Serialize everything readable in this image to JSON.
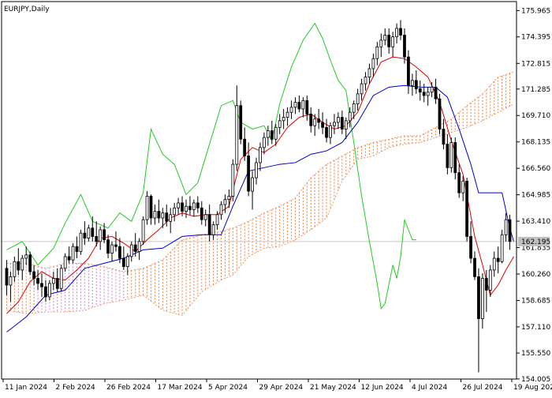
{
  "window": {
    "symbol_label": "EURJPY,Daily"
  },
  "chart_data": {
    "type": "candlestick",
    "title": "EURJPY,Daily",
    "ylim": [
      154.0,
      176.5
    ],
    "y_ticks": [
      "175.965",
      "174.395",
      "172.815",
      "171.285",
      "169.710",
      "168.135",
      "166.560",
      "164.985",
      "163.410",
      "161.835",
      "160.260",
      "158.685",
      "157.110",
      "155.550",
      "154.005"
    ],
    "x_ticks": [
      "11 Jan 2024",
      "2 Feb 2024",
      "26 Feb 2024",
      "17 Mar 2024",
      "5 Apr 2024",
      "29 Apr 2024",
      "21 May 2024",
      "12 Jun 2024",
      "4 Jul 2024",
      "26 Jul 2024",
      "19 Aug 2024"
    ],
    "last_price": "162.195",
    "colors": {
      "candle": "#000000",
      "tenkan": "#dd0000",
      "kijun": "#0000cc",
      "chikou": "#22cc22",
      "cloud": "#f08040",
      "cloud_alt": "#cc88cc",
      "grid": "#c8c8c8",
      "price_tag": "#c0c0c0"
    },
    "candles": [
      [
        160.6,
        161.1,
        159.0,
        159.6
      ],
      [
        159.6,
        160.4,
        158.6,
        160.1
      ],
      [
        160.1,
        161.3,
        159.8,
        161.0
      ],
      [
        161.0,
        161.8,
        160.2,
        160.5
      ],
      [
        160.5,
        161.4,
        159.9,
        161.2
      ],
      [
        161.2,
        161.9,
        160.8,
        161.4
      ],
      [
        161.4,
        161.6,
        160.2,
        160.4
      ],
      [
        160.4,
        160.8,
        159.6,
        160.0
      ],
      [
        160.0,
        160.5,
        159.3,
        159.7
      ],
      [
        159.7,
        160.3,
        158.9,
        159.5
      ],
      [
        159.5,
        159.9,
        158.6,
        158.9
      ],
      [
        158.9,
        159.9,
        158.7,
        159.7
      ],
      [
        159.7,
        160.4,
        159.3,
        160.0
      ],
      [
        160.0,
        160.6,
        159.2,
        159.4
      ],
      [
        159.4,
        160.8,
        159.2,
        160.6
      ],
      [
        160.6,
        161.5,
        160.4,
        161.3
      ],
      [
        161.3,
        161.9,
        160.9,
        161.1
      ],
      [
        161.1,
        162.1,
        160.9,
        161.9
      ],
      [
        161.9,
        162.5,
        161.2,
        161.6
      ],
      [
        161.6,
        162.9,
        161.4,
        162.7
      ],
      [
        162.7,
        163.4,
        162.0,
        162.4
      ],
      [
        162.4,
        163.2,
        162.2,
        163.0
      ],
      [
        163.0,
        163.7,
        162.2,
        162.5
      ],
      [
        162.5,
        163.4,
        161.9,
        162.2
      ],
      [
        162.2,
        163.1,
        161.7,
        162.9
      ],
      [
        162.9,
        163.3,
        162.1,
        162.3
      ],
      [
        162.3,
        162.6,
        161.2,
        161.5
      ],
      [
        161.5,
        162.2,
        161.0,
        162.0
      ],
      [
        162.0,
        162.8,
        161.6,
        161.9
      ],
      [
        161.9,
        162.4,
        160.9,
        161.2
      ],
      [
        161.2,
        161.9,
        160.5,
        160.7
      ],
      [
        160.7,
        161.5,
        160.2,
        161.3
      ],
      [
        161.3,
        162.2,
        161.0,
        162.0
      ],
      [
        162.0,
        162.7,
        161.3,
        161.6
      ],
      [
        161.6,
        162.4,
        161.1,
        162.2
      ],
      [
        162.2,
        163.7,
        162.0,
        163.5
      ],
      [
        163.5,
        165.2,
        163.2,
        164.9
      ],
      [
        164.9,
        165.0,
        163.2,
        163.6
      ],
      [
        163.6,
        164.4,
        163.2,
        164.0
      ],
      [
        164.0,
        164.7,
        163.3,
        163.6
      ],
      [
        163.6,
        164.2,
        163.0,
        163.9
      ],
      [
        163.9,
        164.4,
        163.1,
        163.4
      ],
      [
        163.4,
        164.2,
        162.7,
        163.8
      ],
      [
        163.8,
        164.5,
        163.4,
        164.2
      ],
      [
        164.2,
        164.8,
        163.8,
        164.5
      ],
      [
        164.5,
        164.9,
        163.7,
        164.0
      ],
      [
        164.0,
        164.7,
        163.6,
        164.3
      ],
      [
        164.3,
        164.9,
        163.8,
        164.1
      ],
      [
        164.1,
        164.7,
        163.7,
        164.5
      ],
      [
        164.5,
        164.9,
        163.9,
        164.2
      ],
      [
        164.2,
        164.6,
        163.2,
        163.5
      ],
      [
        163.5,
        164.1,
        163.1,
        163.8
      ],
      [
        163.8,
        164.4,
        162.2,
        162.6
      ],
      [
        162.6,
        163.4,
        162.3,
        163.2
      ],
      [
        163.2,
        164.0,
        162.9,
        163.8
      ],
      [
        163.8,
        164.6,
        163.5,
        164.4
      ],
      [
        164.4,
        165.0,
        163.9,
        164.7
      ],
      [
        164.7,
        165.3,
        164.2,
        164.9
      ],
      [
        164.9,
        167.1,
        164.6,
        166.8
      ],
      [
        166.8,
        171.5,
        166.4,
        170.3
      ],
      [
        170.3,
        170.6,
        168.0,
        168.3
      ],
      [
        168.3,
        169.0,
        167.0,
        167.3
      ],
      [
        167.3,
        168.1,
        164.9,
        165.2
      ],
      [
        165.2,
        166.4,
        164.1,
        166.0
      ],
      [
        166.0,
        167.2,
        165.6,
        166.9
      ],
      [
        166.9,
        168.1,
        166.4,
        167.8
      ],
      [
        167.8,
        168.7,
        167.4,
        168.4
      ],
      [
        168.4,
        169.1,
        167.9,
        168.8
      ],
      [
        168.8,
        169.4,
        168.0,
        168.3
      ],
      [
        168.3,
        169.2,
        167.9,
        169.0
      ],
      [
        169.0,
        169.8,
        168.6,
        169.4
      ],
      [
        169.4,
        170.1,
        168.9,
        169.6
      ],
      [
        169.6,
        170.2,
        169.1,
        169.9
      ],
      [
        169.9,
        170.6,
        169.5,
        170.2
      ],
      [
        170.2,
        170.8,
        169.8,
        170.5
      ],
      [
        170.5,
        170.9,
        169.9,
        170.1
      ],
      [
        170.1,
        170.8,
        169.6,
        170.6
      ],
      [
        170.6,
        170.9,
        169.4,
        169.8
      ],
      [
        169.8,
        170.2,
        168.7,
        169.1
      ],
      [
        169.1,
        169.8,
        168.5,
        169.5
      ],
      [
        169.5,
        170.1,
        168.9,
        169.3
      ],
      [
        169.3,
        169.9,
        168.6,
        169.0
      ],
      [
        169.0,
        169.5,
        168.1,
        168.4
      ],
      [
        168.4,
        169.3,
        168.0,
        169.1
      ],
      [
        169.1,
        169.8,
        168.6,
        169.3
      ],
      [
        169.3,
        169.9,
        168.9,
        169.6
      ],
      [
        169.6,
        170.0,
        168.6,
        168.9
      ],
      [
        168.9,
        169.6,
        168.3,
        169.4
      ],
      [
        169.4,
        170.2,
        169.0,
        169.9
      ],
      [
        169.9,
        170.6,
        169.5,
        170.4
      ],
      [
        170.4,
        171.3,
        170.0,
        171.0
      ],
      [
        171.0,
        171.9,
        170.6,
        171.6
      ],
      [
        171.6,
        172.3,
        171.2,
        172.0
      ],
      [
        172.0,
        172.8,
        171.6,
        172.5
      ],
      [
        172.5,
        173.4,
        172.0,
        173.1
      ],
      [
        173.1,
        174.1,
        172.7,
        173.8
      ],
      [
        173.8,
        174.6,
        173.2,
        174.2
      ],
      [
        174.2,
        174.9,
        173.9,
        174.5
      ],
      [
        174.5,
        174.9,
        173.4,
        173.8
      ],
      [
        173.8,
        174.7,
        173.2,
        174.4
      ],
      [
        174.4,
        175.2,
        174.0,
        174.9
      ],
      [
        174.9,
        175.4,
        174.2,
        174.5
      ],
      [
        174.5,
        174.9,
        172.8,
        173.2
      ],
      [
        173.2,
        173.6,
        171.0,
        171.5
      ],
      [
        171.5,
        172.2,
        170.9,
        171.8
      ],
      [
        171.8,
        172.4,
        171.0,
        171.3
      ],
      [
        171.3,
        171.8,
        170.6,
        171.1
      ],
      [
        171.1,
        171.6,
        170.5,
        170.9
      ],
      [
        170.9,
        171.4,
        170.3,
        171.1
      ],
      [
        171.1,
        171.7,
        170.8,
        171.4
      ],
      [
        171.4,
        171.9,
        170.4,
        170.7
      ],
      [
        170.7,
        171.0,
        168.6,
        168.9
      ],
      [
        168.9,
        169.5,
        167.7,
        168.0
      ],
      [
        168.0,
        168.6,
        166.2,
        166.6
      ],
      [
        166.6,
        168.4,
        166.3,
        168.1
      ],
      [
        168.1,
        168.4,
        165.9,
        166.3
      ],
      [
        166.3,
        166.8,
        164.8,
        165.1
      ],
      [
        165.1,
        166.1,
        164.6,
        165.8
      ],
      [
        165.8,
        166.0,
        162.2,
        162.5
      ],
      [
        162.5,
        163.4,
        160.9,
        161.2
      ],
      [
        161.2,
        161.6,
        159.9,
        160.1
      ],
      [
        160.1,
        160.6,
        154.4,
        157.6
      ],
      [
        157.6,
        160.3,
        157.0,
        160.0
      ],
      [
        160.0,
        160.5,
        158.0,
        159.3
      ],
      [
        159.3,
        160.8,
        158.9,
        160.5
      ],
      [
        160.5,
        161.6,
        160.1,
        161.2
      ],
      [
        161.2,
        161.9,
        160.3,
        161.0
      ],
      [
        161.0,
        162.9,
        160.9,
        162.6
      ],
      [
        162.6,
        163.9,
        162.2,
        163.5
      ],
      [
        163.5,
        163.8,
        161.7,
        162.2
      ]
    ],
    "tenkan": [
      [
        0,
        157.9
      ],
      [
        3,
        158.6
      ],
      [
        6,
        159.8
      ],
      [
        9,
        160.4
      ],
      [
        12,
        160.0
      ],
      [
        15,
        159.9
      ],
      [
        18,
        160.5
      ],
      [
        21,
        161.2
      ],
      [
        24,
        162.4
      ],
      [
        27,
        162.5
      ],
      [
        30,
        162.1
      ],
      [
        33,
        161.6
      ],
      [
        36,
        162.3
      ],
      [
        39,
        162.9
      ],
      [
        42,
        163.6
      ],
      [
        45,
        163.9
      ],
      [
        48,
        163.7
      ],
      [
        51,
        163.8
      ],
      [
        54,
        163.8
      ],
      [
        57,
        164.3
      ],
      [
        60,
        167.1
      ],
      [
        63,
        167.8
      ],
      [
        66,
        167.5
      ],
      [
        69,
        168.0
      ],
      [
        72,
        169.0
      ],
      [
        75,
        169.6
      ],
      [
        78,
        169.8
      ],
      [
        81,
        169.3
      ],
      [
        84,
        168.9
      ],
      [
        87,
        169.1
      ],
      [
        90,
        169.9
      ],
      [
        93,
        171.6
      ],
      [
        96,
        172.9
      ],
      [
        99,
        173.2
      ],
      [
        102,
        173.1
      ],
      [
        105,
        172.6
      ],
      [
        108,
        172.0
      ],
      [
        111,
        170.5
      ],
      [
        114,
        168.2
      ],
      [
        117,
        166.2
      ],
      [
        120,
        162.5
      ],
      [
        122,
        160.8
      ],
      [
        124,
        159.0
      ],
      [
        126,
        159.6
      ],
      [
        128,
        160.5
      ],
      [
        130,
        161.3
      ]
    ],
    "kijun": [
      [
        0,
        156.8
      ],
      [
        5,
        157.7
      ],
      [
        10,
        159.0
      ],
      [
        15,
        159.3
      ],
      [
        20,
        160.6
      ],
      [
        25,
        160.9
      ],
      [
        30,
        161.2
      ],
      [
        35,
        161.7
      ],
      [
        40,
        161.8
      ],
      [
        45,
        162.5
      ],
      [
        50,
        162.6
      ],
      [
        55,
        162.6
      ],
      [
        58,
        164.3
      ],
      [
        62,
        166.4
      ],
      [
        66,
        166.6
      ],
      [
        70,
        166.8
      ],
      [
        74,
        166.9
      ],
      [
        78,
        167.4
      ],
      [
        82,
        167.6
      ],
      [
        86,
        168.1
      ],
      [
        90,
        169.3
      ],
      [
        94,
        170.9
      ],
      [
        98,
        171.4
      ],
      [
        102,
        171.5
      ],
      [
        106,
        171.4
      ],
      [
        110,
        171.4
      ],
      [
        113,
        170.8
      ],
      [
        116,
        168.9
      ],
      [
        119,
        166.8
      ],
      [
        121,
        165.1
      ],
      [
        127,
        165.1
      ],
      [
        129,
        163.0
      ],
      [
        130,
        162.2
      ]
    ],
    "chikou": [
      [
        0,
        161.7
      ],
      [
        4,
        162.2
      ],
      [
        8,
        160.8
      ],
      [
        12,
        161.8
      ],
      [
        15,
        163.3
      ],
      [
        19,
        165.0
      ],
      [
        22,
        163.4
      ],
      [
        26,
        163.0
      ],
      [
        29,
        163.9
      ],
      [
        32,
        163.4
      ],
      [
        35,
        165.1
      ],
      [
        37,
        168.9
      ],
      [
        40,
        167.4
      ],
      [
        43,
        166.8
      ],
      [
        46,
        165.0
      ],
      [
        49,
        165.7
      ],
      [
        52,
        168.0
      ],
      [
        55,
        170.3
      ],
      [
        58,
        170.6
      ],
      [
        60,
        169.3
      ],
      [
        63,
        168.9
      ],
      [
        66,
        169.1
      ],
      [
        68,
        168.2
      ],
      [
        70,
        170.4
      ],
      [
        73,
        172.6
      ],
      [
        76,
        174.2
      ],
      [
        79,
        175.2
      ],
      [
        81,
        174.3
      ],
      [
        83,
        173.0
      ],
      [
        85,
        171.8
      ],
      [
        87,
        171.2
      ],
      [
        89,
        168.1
      ],
      [
        91,
        164.9
      ],
      [
        93,
        162.2
      ],
      [
        95,
        159.7
      ],
      [
        96,
        158.2
      ],
      [
        97,
        158.5
      ],
      [
        99,
        160.8
      ],
      [
        100,
        160.0
      ],
      [
        101,
        161.3
      ],
      [
        102,
        163.5
      ],
      [
        104,
        162.3
      ],
      [
        105,
        162.3
      ]
    ],
    "cloud_upper": [
      [
        0,
        160.9
      ],
      [
        5,
        160.9
      ],
      [
        10,
        160.6
      ],
      [
        15,
        160.9
      ],
      [
        20,
        160.9
      ],
      [
        25,
        160.7
      ],
      [
        30,
        160.4
      ],
      [
        35,
        160.6
      ],
      [
        40,
        161.1
      ],
      [
        45,
        162.3
      ],
      [
        50,
        162.6
      ],
      [
        55,
        162.8
      ],
      [
        58,
        163.0
      ],
      [
        62,
        163.4
      ],
      [
        66,
        163.9
      ],
      [
        70,
        164.3
      ],
      [
        74,
        164.8
      ],
      [
        78,
        166.0
      ],
      [
        82,
        166.8
      ],
      [
        86,
        167.3
      ],
      [
        90,
        167.8
      ],
      [
        94,
        168.1
      ],
      [
        98,
        168.3
      ],
      [
        102,
        168.5
      ],
      [
        106,
        168.5
      ],
      [
        110,
        169.0
      ],
      [
        114,
        169.5
      ],
      [
        118,
        170.3
      ],
      [
        122,
        171.0
      ],
      [
        126,
        172.0
      ],
      [
        130,
        172.3
      ]
    ],
    "cloud_lower": [
      [
        0,
        158.1
      ],
      [
        5,
        157.9
      ],
      [
        10,
        158.0
      ],
      [
        15,
        158.0
      ],
      [
        20,
        158.1
      ],
      [
        25,
        158.5
      ],
      [
        30,
        158.7
      ],
      [
        35,
        159.0
      ],
      [
        40,
        158.1
      ],
      [
        45,
        157.8
      ],
      [
        50,
        159.2
      ],
      [
        55,
        159.9
      ],
      [
        58,
        160.2
      ],
      [
        62,
        161.3
      ],
      [
        66,
        161.8
      ],
      [
        70,
        161.9
      ],
      [
        74,
        162.3
      ],
      [
        78,
        162.9
      ],
      [
        82,
        163.6
      ],
      [
        86,
        165.8
      ],
      [
        90,
        167.1
      ],
      [
        94,
        167.3
      ],
      [
        98,
        167.8
      ],
      [
        102,
        168.0
      ],
      [
        106,
        168.1
      ],
      [
        110,
        168.4
      ],
      [
        114,
        168.7
      ],
      [
        118,
        169.0
      ],
      [
        122,
        169.4
      ],
      [
        126,
        169.9
      ],
      [
        130,
        170.4
      ]
    ],
    "grid": true
  }
}
